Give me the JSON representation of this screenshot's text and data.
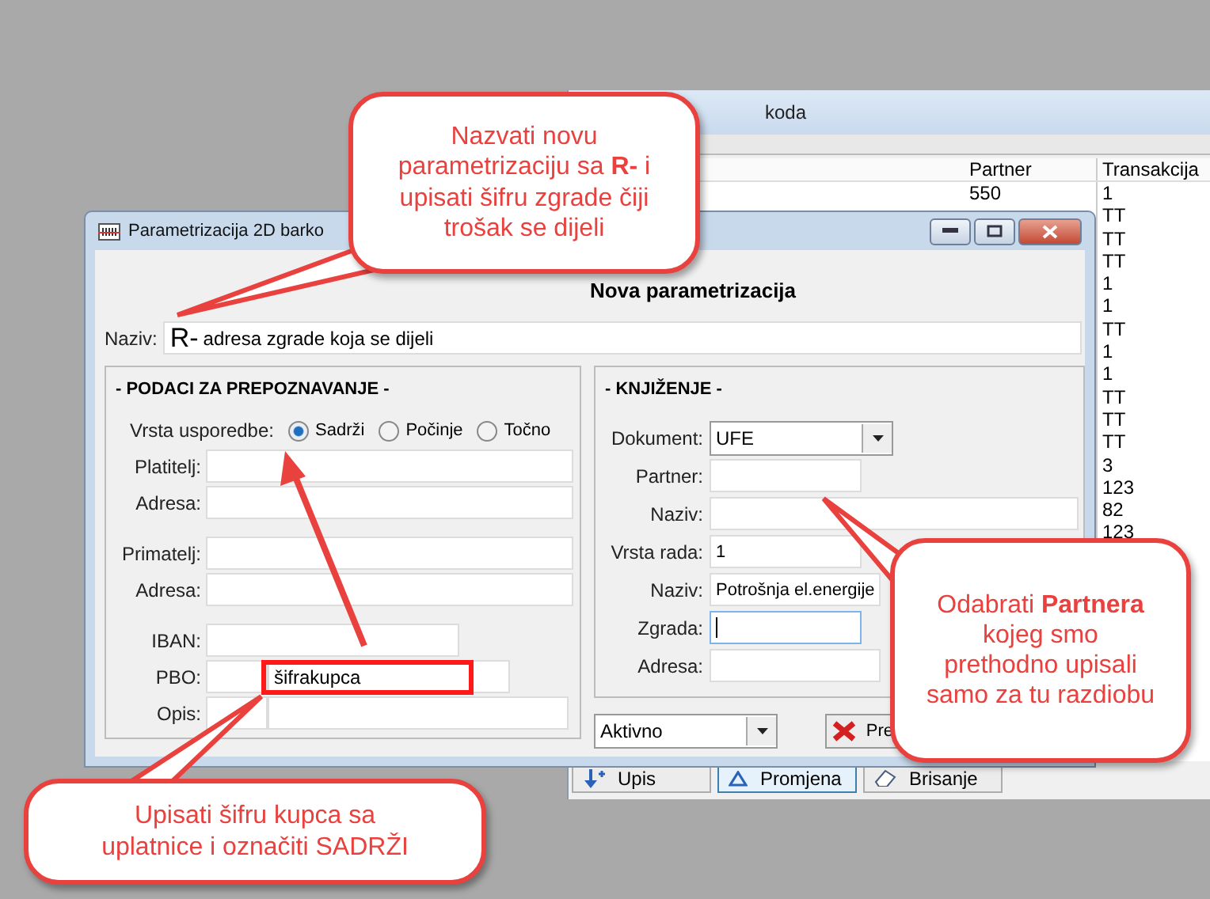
{
  "back_window": {
    "title": "koda",
    "columns": [
      "Partner",
      "Transakcija"
    ],
    "rows": [
      {
        "partner": "550",
        "transakcija": "1"
      },
      {
        "transakcija": "TT"
      },
      {
        "transakcija": "TT"
      },
      {
        "transakcija": "TT"
      },
      {
        "transakcija": "1"
      },
      {
        "transakcija": "1"
      },
      {
        "transakcija": "TT"
      },
      {
        "transakcija": "1"
      },
      {
        "transakcija": "1"
      },
      {
        "transakcija": "TT"
      },
      {
        "transakcija": "TT"
      },
      {
        "transakcija": "TT"
      },
      {
        "transakcija": "3"
      },
      {
        "transakcija": "123"
      },
      {
        "transakcija": "82"
      },
      {
        "transakcija": "123"
      }
    ],
    "buttons": [
      {
        "label": "Upis",
        "kind": "add"
      },
      {
        "label": "Promjena",
        "kind": "edit",
        "selected": true
      },
      {
        "label": "Brisanje",
        "kind": "delete",
        "selected": false
      }
    ]
  },
  "dialog": {
    "title": "Parametrizacija 2D barko",
    "heading": "Nova parametrizacija",
    "naziv": {
      "label": "Naziv:",
      "prefix": "R-",
      "value": "adresa zgrade koja se dijeli"
    },
    "left_panel": {
      "title": "- PODACI ZA PREPOZNAVANJE -",
      "compare_label": "Vrsta usporedbe:",
      "options": [
        {
          "label": "Sadrži",
          "selected": true
        },
        {
          "label": "Počinje",
          "selected": false
        },
        {
          "label": "Točno",
          "selected": false
        }
      ],
      "groups": [
        [
          {
            "label": "Platitelj:"
          },
          {
            "label": "Adresa:"
          }
        ],
        [
          {
            "label": "Primatelj:"
          },
          {
            "label": "Adresa:"
          }
        ],
        [
          {
            "label": "IBAN:",
            "kind": "short"
          },
          {
            "label": "PBO:",
            "kind": "split",
            "value": "šifrakupca",
            "highlighted": true
          },
          {
            "label": "Opis:",
            "kind": "split"
          }
        ]
      ]
    },
    "right_panel": {
      "title": "- KNJIŽENJE -",
      "fields": [
        {
          "label": "Dokument:",
          "kind": "combo",
          "value": "UFE"
        },
        {
          "label": "Partner:",
          "kind": "short"
        },
        {
          "label": "Naziv:",
          "kind": "long"
        },
        {
          "label": "Vrsta rada:",
          "kind": "short",
          "value": "1"
        },
        {
          "label": "Naziv:",
          "kind": "long",
          "value": "Potrošnja el.energije"
        },
        {
          "label": "Zgrada:",
          "kind": "short",
          "focused": true
        },
        {
          "label": "Adresa:",
          "kind": "long"
        }
      ]
    },
    "status_combo": "Aktivno",
    "cancel_button": "Pre"
  },
  "callouts": [
    {
      "text": "Nazvati novu parametrizaciju sa **R-** i upisati šifru zgrade čiji trošak se dijeli"
    },
    {
      "text": "Upisati šifru kupca sa uplatnice i označiti SADRŽI"
    },
    {
      "text": "Odabrati **Partnera** kojeg smo prethodno upisali samo za tu razdiobu"
    }
  ]
}
